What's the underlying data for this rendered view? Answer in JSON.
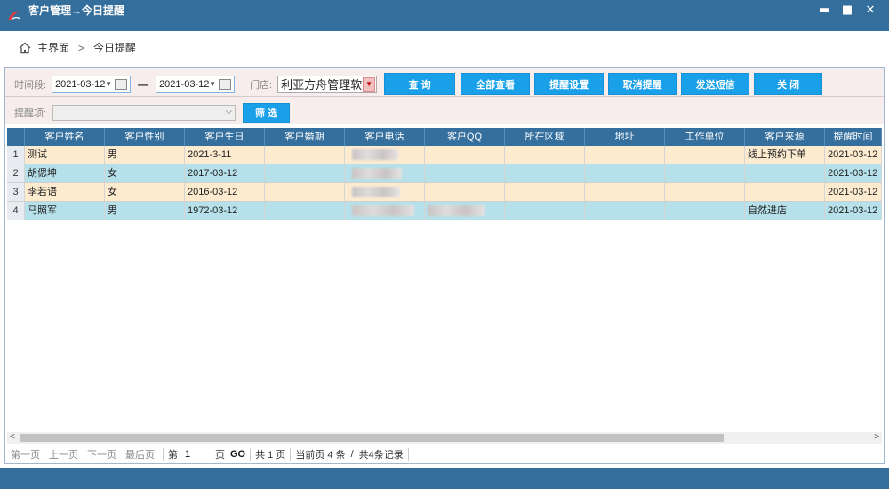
{
  "window": {
    "title": "客户管理→今日提醒",
    "minimize": "▬",
    "maximize": "■",
    "close": "✕"
  },
  "breadcrumb": {
    "home": "主界面",
    "separator": ">",
    "current": "今日提醒"
  },
  "filter": {
    "period_label": "时间段:",
    "date_from": "2021-03-12",
    "date_to": "2021-03-12",
    "date_dash": "—",
    "store_label": "门店:",
    "store_value": "利亚方舟管理软",
    "reminder_label": "提醒项:",
    "reminder_value": "",
    "buttons": {
      "query": "查 询",
      "view_all": "全部查看",
      "settings": "提醒设置",
      "cancel_reminder": "取消提醒",
      "send_sms": "发送短信",
      "close": "关 闭",
      "filter": "筛 选"
    }
  },
  "grid": {
    "columns": [
      "客户姓名",
      "客户性别",
      "客户生日",
      "客户婚期",
      "客户电话",
      "客户QQ",
      "所在区域",
      "地址",
      "工作单位",
      "客户来源",
      "提醒时间"
    ],
    "rows": [
      {
        "n": "1",
        "name": "测试",
        "gender": "男",
        "birthday": "2021-3-11",
        "wedding": "",
        "phone": "",
        "qq": "",
        "area": "",
        "address": "",
        "employer": "",
        "source": "线上预约下单",
        "remind": "2021-03-12"
      },
      {
        "n": "2",
        "name": "胡偲坤",
        "gender": "女",
        "birthday": "2017-03-12",
        "wedding": "",
        "phone": "",
        "qq": "",
        "area": "",
        "address": "",
        "employer": "",
        "source": "",
        "remind": "2021-03-12"
      },
      {
        "n": "3",
        "name": "李若语",
        "gender": "女",
        "birthday": "2016-03-12",
        "wedding": "",
        "phone": "",
        "qq": "",
        "area": "",
        "address": "",
        "employer": "",
        "source": "",
        "remind": "2021-03-12"
      },
      {
        "n": "4",
        "name": "马照军",
        "gender": "男",
        "birthday": "1972-03-12",
        "wedding": "",
        "phone": "",
        "qq": "",
        "area": "",
        "address": "",
        "employer": "",
        "source": "自然进店",
        "remind": "2021-03-12"
      }
    ]
  },
  "pager": {
    "first": "第一页",
    "prev": "上一页",
    "next": "下一页",
    "last": "最后页",
    "page_prefix": "第",
    "page_value": "1",
    "page_suffix": "页",
    "go": "GO",
    "total_pages": "共 1 页",
    "current_count": "当前页 4 条",
    "slash": "/",
    "total_records": "共4条记录"
  },
  "colors": {
    "titlebar": "#336e9c",
    "header": "#346f9e",
    "button": "#1aa0e8",
    "row_odd": "#fdebd0",
    "row_even": "#b7e1ea"
  }
}
